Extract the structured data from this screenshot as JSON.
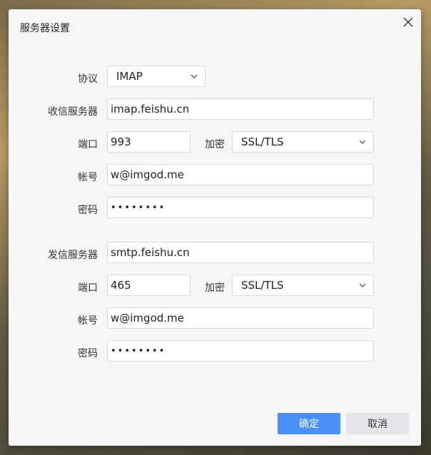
{
  "dialog": {
    "title": "服务器设置"
  },
  "protocol": {
    "label": "协议",
    "value": "IMAP"
  },
  "incoming": {
    "server_label": "收信服务器",
    "server": "imap.feishu.cn",
    "port_label": "端口",
    "port": "993",
    "encrypt_label": "加密",
    "encrypt": "SSL/TLS",
    "account_label": "帐号",
    "account": "w@imgod.me",
    "password_label": "密码",
    "password": "••••••••"
  },
  "outgoing": {
    "server_label": "发信服务器",
    "server": "smtp.feishu.cn",
    "port_label": "端口",
    "port": "465",
    "encrypt_label": "加密",
    "encrypt": "SSL/TLS",
    "account_label": "帐号",
    "account": "w@imgod.me",
    "password_label": "密码",
    "password": "••••••••"
  },
  "buttons": {
    "confirm": "确定",
    "cancel": "取消"
  },
  "colors": {
    "primary": "#4a8ff5",
    "secondary": "#e4e6ea",
    "dialog_bg": "#f5f6f8"
  }
}
